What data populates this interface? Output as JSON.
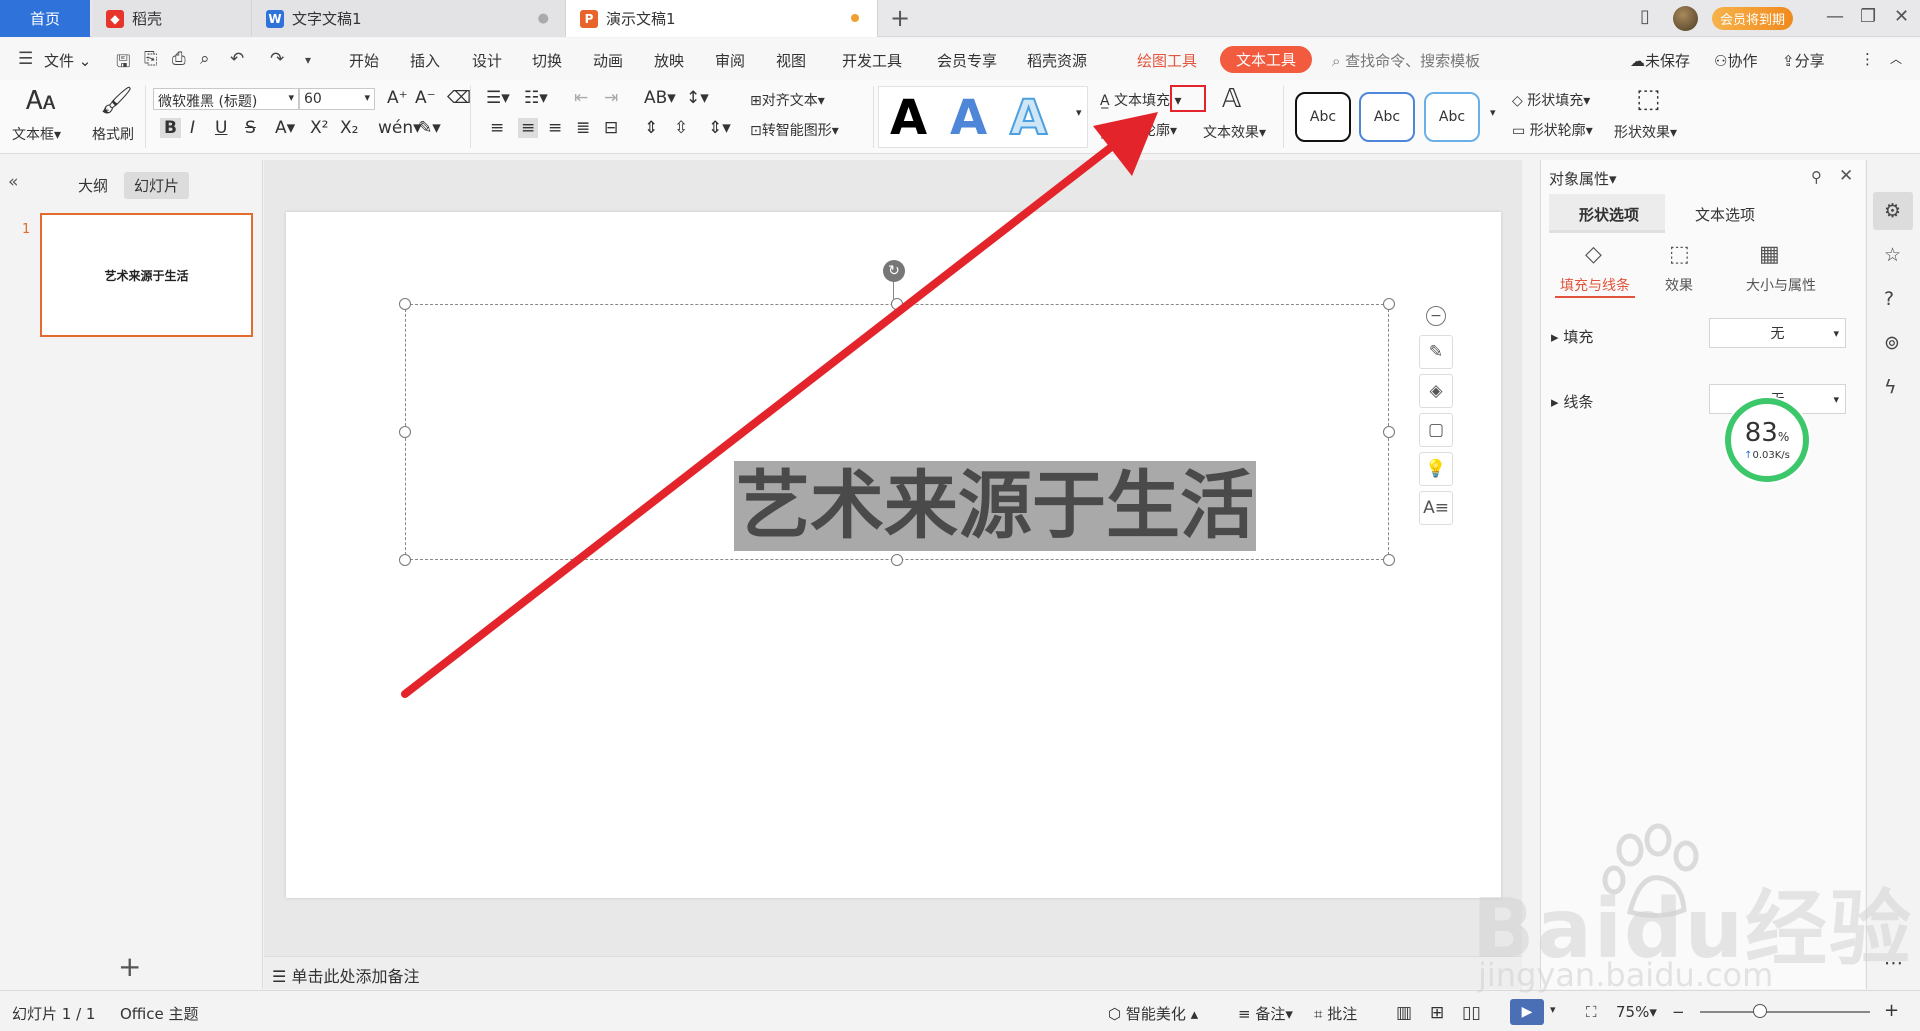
{
  "tabs": {
    "home": "首页",
    "daoke": "稻壳",
    "doc_writer": "文字文稿1",
    "doc_presentation": "演示文稿1",
    "vip": "会员将到期"
  },
  "menu": {
    "file": "文件",
    "items": [
      "开始",
      "插入",
      "设计",
      "切换",
      "动画",
      "放映",
      "审阅",
      "视图",
      "开发工具",
      "会员专享",
      "稻壳资源"
    ],
    "drawing_tool": "绘图工具",
    "text_tool": "文本工具",
    "search_placeholder": "查找命令、搜索模板",
    "unsaved": "未保存",
    "collaborate": "协作",
    "share": "分享"
  },
  "ribbon": {
    "textbox": "文本框",
    "format_painter": "格式刷",
    "font_name": "微软雅黑 (标题)",
    "font_size": "60",
    "align_text": "对齐文本",
    "smart_shape": "转智能图形",
    "text_fill": "文本填充",
    "text_outline": "文本轮廓",
    "text_effect": "文本效果",
    "style_a": "A",
    "abc": "Abc",
    "shape_fill": "形状填充",
    "shape_outline": "形状轮廓",
    "shape_effect": "形状效果"
  },
  "left_panel": {
    "outline_tab": "大纲",
    "slides_tab": "幻灯片",
    "slide_number": "1",
    "thumb_title": "艺术来源于生活"
  },
  "slide": {
    "title": "艺术来源于生活"
  },
  "notes": {
    "placeholder": "单击此处添加备注"
  },
  "property_panel": {
    "title": "对象属性",
    "tab_shape": "形状选项",
    "tab_text": "文本选项",
    "sub_fill_line": "填充与线条",
    "sub_effect": "效果",
    "sub_size": "大小与属性",
    "fill_label": "填充",
    "fill_value": "无",
    "line_label": "线条",
    "line_value": "无"
  },
  "speed_widget": {
    "percent": "83",
    "percent_sign": "%",
    "rate": "0.03K/s"
  },
  "status": {
    "slide_count": "幻灯片 1 / 1",
    "theme": "Office 主题",
    "smart_beautify": "智能美化",
    "notes": "备注",
    "comments": "批注",
    "zoom": "75%"
  },
  "watermark": {
    "main": "Baidu经验",
    "sub": "jingyan.baidu.com"
  },
  "colors": {
    "accent_blue": "#2f72d9",
    "accent_red": "#f25b3e",
    "annotation_red": "#e3242b"
  }
}
